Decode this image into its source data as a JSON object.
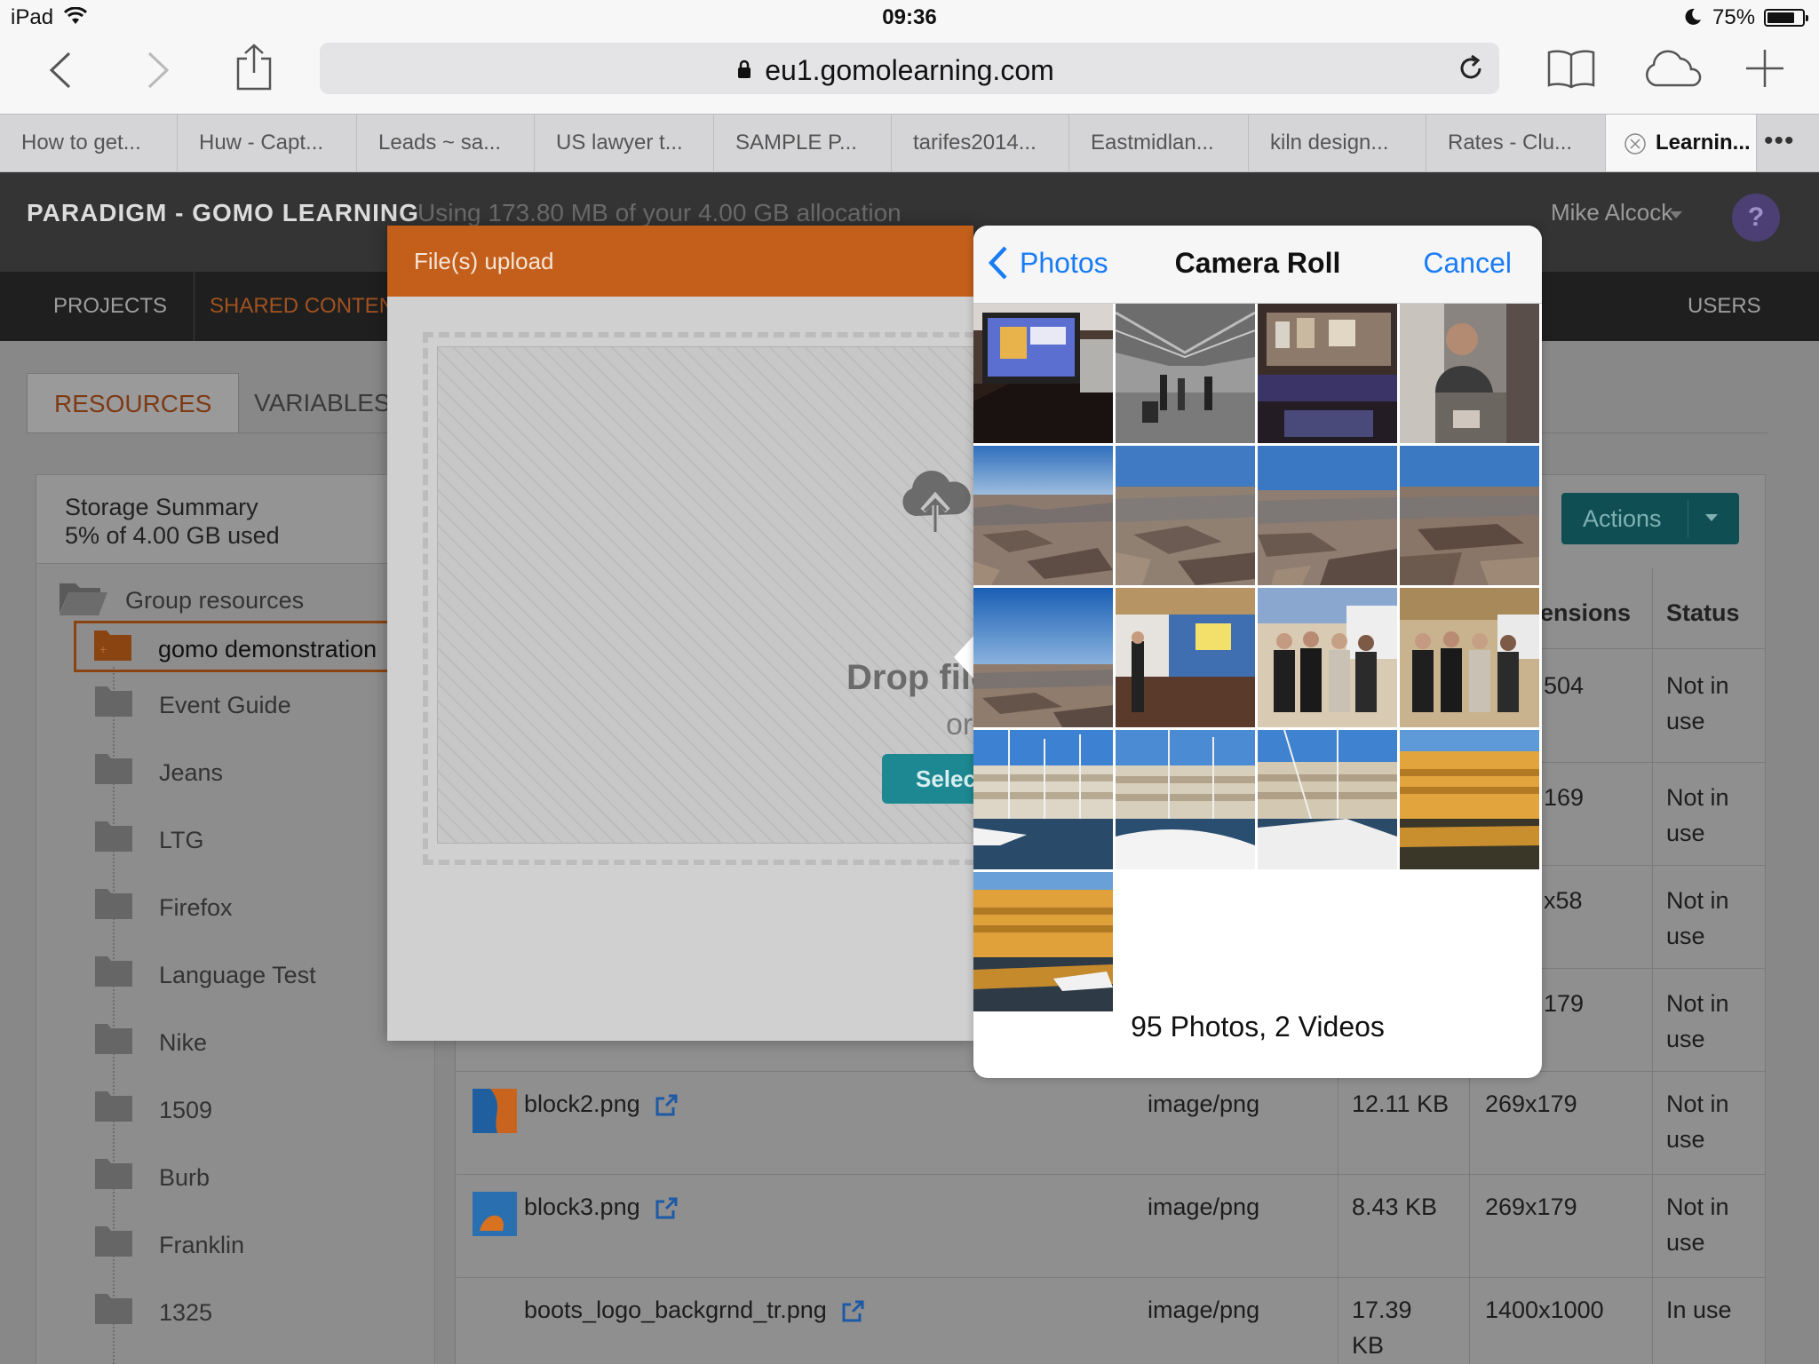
{
  "status_bar": {
    "device": "iPad",
    "time": "09:36",
    "battery": "75%"
  },
  "browser": {
    "url": "eu1.gomolearning.com",
    "tabs": [
      {
        "title": "How to get..."
      },
      {
        "title": "Huw - Capt..."
      },
      {
        "title": "Leads ~ sa..."
      },
      {
        "title": "US lawyer t..."
      },
      {
        "title": "SAMPLE P..."
      },
      {
        "title": "tarifes2014..."
      },
      {
        "title": "Eastmidlan..."
      },
      {
        "title": "kiln design..."
      },
      {
        "title": "Rates - Clu..."
      },
      {
        "title": "Learnin..."
      }
    ],
    "tabs_more": "•••"
  },
  "app": {
    "brand": "PARADIGM - GOMO LEARNING",
    "usage": "Using 173.80 MB of your 4.00 GB allocation",
    "user": "Mike Alcock",
    "help": "?",
    "nav": {
      "projects": "PROJECTS",
      "shared": "SHARED CONTENT",
      "users": "USERS"
    },
    "subtabs": {
      "resources": "RESOURCES",
      "variables": "VARIABLES"
    },
    "storage": {
      "title": "Storage Summary",
      "used": "5% of 4.00 GB used"
    },
    "folders": [
      {
        "label": "Group resources"
      },
      {
        "label": "gomo demonstration"
      },
      {
        "label": "Event Guide"
      },
      {
        "label": "Jeans"
      },
      {
        "label": "LTG"
      },
      {
        "label": "Firefox"
      },
      {
        "label": "Language Test"
      },
      {
        "label": "Nike"
      },
      {
        "label": "1509"
      },
      {
        "label": "Burb"
      },
      {
        "label": "Franklin"
      },
      {
        "label": "1325"
      }
    ],
    "actions": "Actions",
    "columns": {
      "dimensions": "ensions",
      "status": "Status"
    },
    "partial_rows": [
      {
        "dim": "504",
        "status": "Not in use"
      },
      {
        "dim": "169",
        "status": "Not in use"
      },
      {
        "dim": "x58",
        "status": "Not in use"
      },
      {
        "dim": "179",
        "status": "Not in use"
      }
    ],
    "files": [
      {
        "name": "block2.png",
        "type": "image/png",
        "size": "12.11 KB",
        "dim": "269x179",
        "status": "Not in use"
      },
      {
        "name": "block3.png",
        "type": "image/png",
        "size": "8.43 KB",
        "dim": "269x179",
        "status": "Not in use"
      },
      {
        "name": "boots_logo_backgrnd_tr.png",
        "type": "image/png",
        "size": "17.39 KB",
        "dim": "1400x1000",
        "status": "In use"
      }
    ]
  },
  "upload": {
    "title": "File(s) upload",
    "drop": "Drop files",
    "or": "or",
    "select": "Select files"
  },
  "picker": {
    "back": "Photos",
    "title": "Camera Roll",
    "cancel": "Cancel",
    "footer": "95 Photos, 2 Videos",
    "photos": [
      {
        "subject": "laptop"
      },
      {
        "subject": "hall"
      },
      {
        "subject": "cafe"
      },
      {
        "subject": "person"
      },
      {
        "subject": "aerial"
      },
      {
        "subject": "aerial"
      },
      {
        "subject": "aerial"
      },
      {
        "subject": "aerial"
      },
      {
        "subject": "aerial"
      },
      {
        "subject": "expo"
      },
      {
        "subject": "group"
      },
      {
        "subject": "group"
      },
      {
        "subject": "harbor"
      },
      {
        "subject": "harbor"
      },
      {
        "subject": "harbor"
      },
      {
        "subject": "harbor-sunset"
      },
      {
        "subject": "harbor-sunset"
      }
    ]
  },
  "colors": {
    "accent_orange": "#c45f1b",
    "ios_blue": "#1a7cf5",
    "teal": "#1d8891"
  }
}
